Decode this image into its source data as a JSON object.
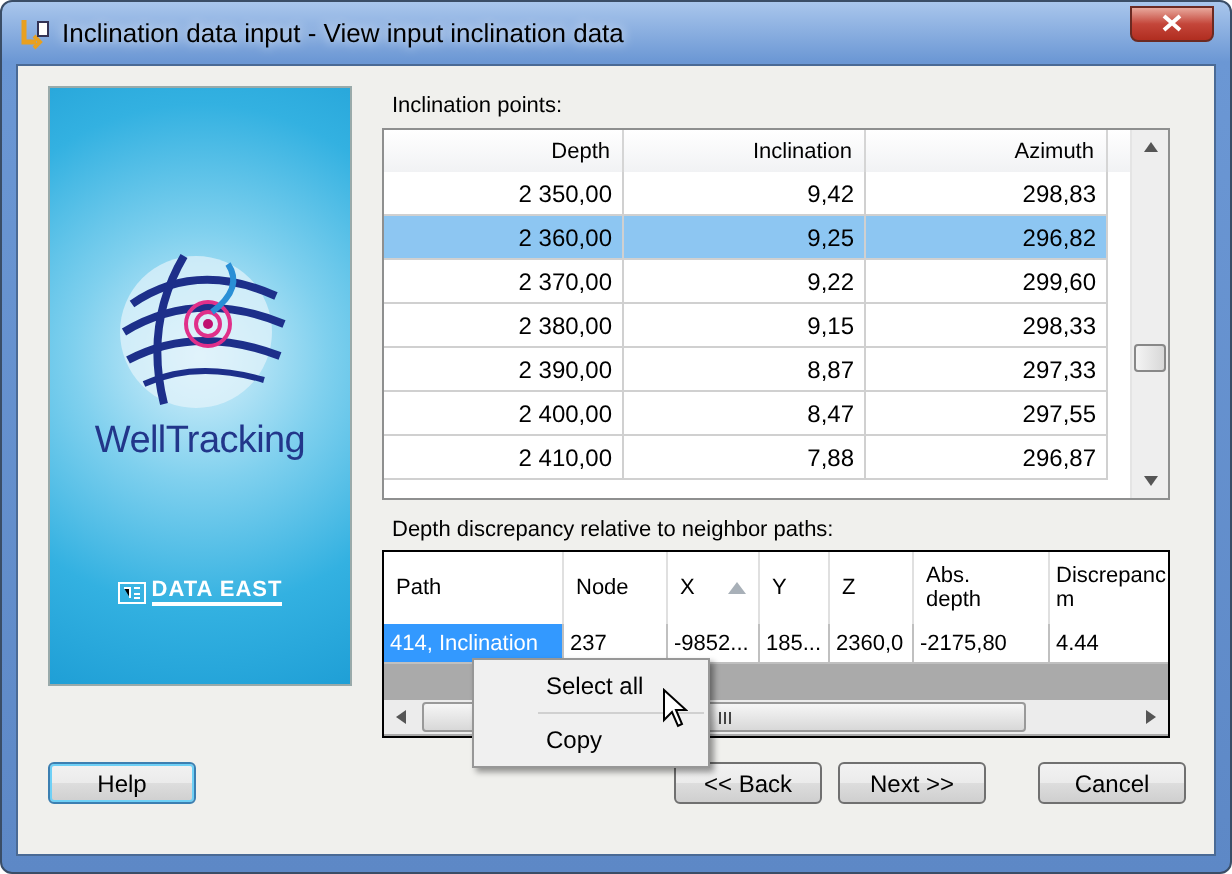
{
  "window": {
    "title": "Inclination data input - View input inclination data"
  },
  "banner": {
    "product": "WellTracking",
    "company": "DATA EAST"
  },
  "inclination_points": {
    "label": "Inclination points:",
    "columns": [
      "Depth",
      "Inclination",
      "Azimuth"
    ],
    "rows": [
      {
        "cells": [
          "2 350,00",
          "9,42",
          "298,83"
        ],
        "selected": false
      },
      {
        "cells": [
          "2 360,00",
          "9,25",
          "296,82"
        ],
        "selected": true
      },
      {
        "cells": [
          "2 370,00",
          "9,22",
          "299,60"
        ],
        "selected": false
      },
      {
        "cells": [
          "2 380,00",
          "9,15",
          "298,33"
        ],
        "selected": false
      },
      {
        "cells": [
          "2 390,00",
          "8,87",
          "297,33"
        ],
        "selected": false
      },
      {
        "cells": [
          "2 400,00",
          "8,47",
          "297,55"
        ],
        "selected": false
      },
      {
        "cells": [
          "2 410,00",
          "7,88",
          "296,87"
        ],
        "selected": false
      }
    ]
  },
  "discrepancy": {
    "label": "Depth discrepancy relative to neighbor paths:",
    "columns": [
      {
        "label": "Path",
        "sorted": false
      },
      {
        "label": "Node",
        "sorted": false
      },
      {
        "label": "X",
        "sorted": true
      },
      {
        "label": "Y",
        "sorted": false
      },
      {
        "label": "Z",
        "sorted": false
      },
      {
        "label": "Abs.\ndepth",
        "sorted": false
      },
      {
        "label": "Discrepanc\nm",
        "sorted": false
      }
    ],
    "rows": [
      {
        "cells": [
          {
            "text": "414, Inclination",
            "selected": true
          },
          {
            "text": "237",
            "selected": false
          },
          {
            "text": "-9852...",
            "selected": false
          },
          {
            "text": "185...",
            "selected": false
          },
          {
            "text": "2360,0",
            "selected": false
          },
          {
            "text": "-2175,80",
            "selected": false
          },
          {
            "text": "4.44",
            "selected": false
          }
        ]
      }
    ]
  },
  "context_menu": {
    "items": [
      {
        "label": "Select all",
        "hovered": false
      },
      {
        "label": "Copy",
        "hovered": false
      }
    ]
  },
  "buttons": [
    {
      "label": "Help",
      "focused": true
    },
    {
      "label": "<< Back",
      "focused": false
    },
    {
      "label": "Next >>",
      "focused": false
    },
    {
      "label": "Cancel",
      "focused": false
    }
  ]
}
